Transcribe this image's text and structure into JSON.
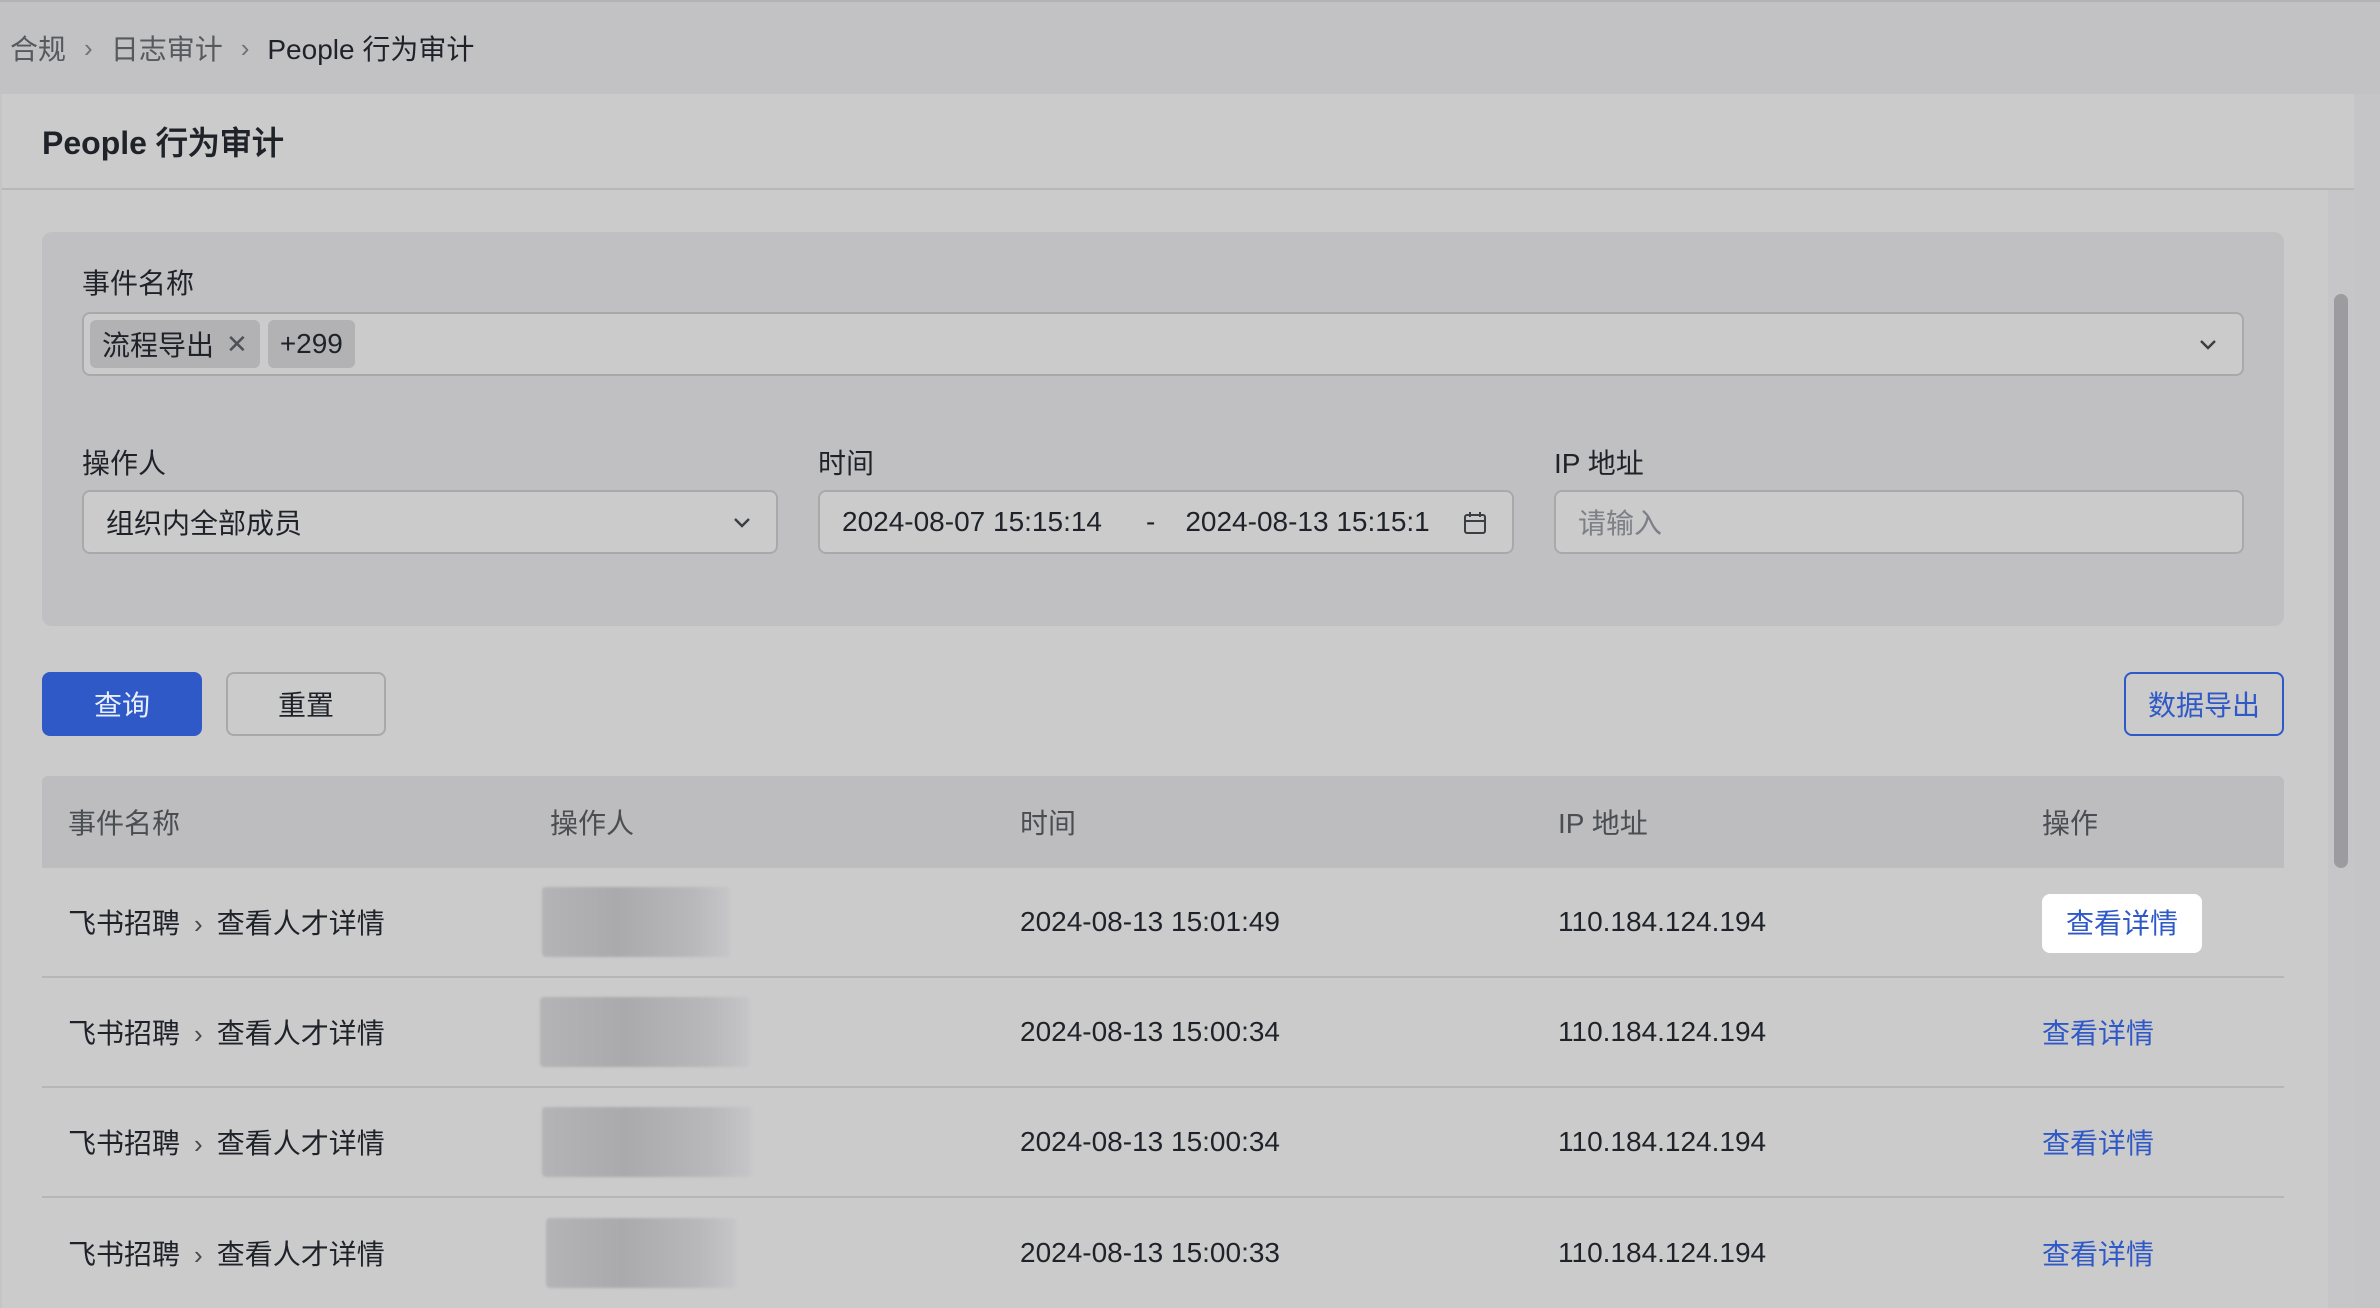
{
  "breadcrumb": [
    "合规",
    "日志审计",
    "People 行为审计"
  ],
  "page_title": "People 行为审计",
  "filters": {
    "event_label": "事件名称",
    "event_tag": "流程导出",
    "event_more": "+299",
    "operator_label": "操作人",
    "operator_value": "组织内全部成员",
    "time_label": "时间",
    "time_start": "2024-08-07 15:15:14",
    "time_sep": "-",
    "time_end": "2024-08-13 15:15:1",
    "ip_label": "IP 地址",
    "ip_placeholder": "请输入"
  },
  "buttons": {
    "query": "查询",
    "reset": "重置",
    "export": "数据导出"
  },
  "table": {
    "headers": [
      "事件名称",
      "操作人",
      "时间",
      "IP 地址",
      "操作"
    ],
    "rows": [
      {
        "app": "飞书招聘",
        "event": "查看人才详情",
        "time": "2024-08-13 15:01:49",
        "ip": "110.184.124.194",
        "action": "查看详情"
      },
      {
        "app": "飞书招聘",
        "event": "查看人才详情",
        "time": "2024-08-13 15:00:34",
        "ip": "110.184.124.194",
        "action": "查看详情"
      },
      {
        "app": "飞书招聘",
        "event": "查看人才详情",
        "time": "2024-08-13 15:00:34",
        "ip": "110.184.124.194",
        "action": "查看详情"
      },
      {
        "app": "飞书招聘",
        "event": "查看人才详情",
        "time": "2024-08-13 15:00:33",
        "ip": "110.184.124.194",
        "action": "查看详情"
      }
    ]
  },
  "colors": {
    "primary": "#2f59c7",
    "highlight_cell": "#ffffff"
  }
}
